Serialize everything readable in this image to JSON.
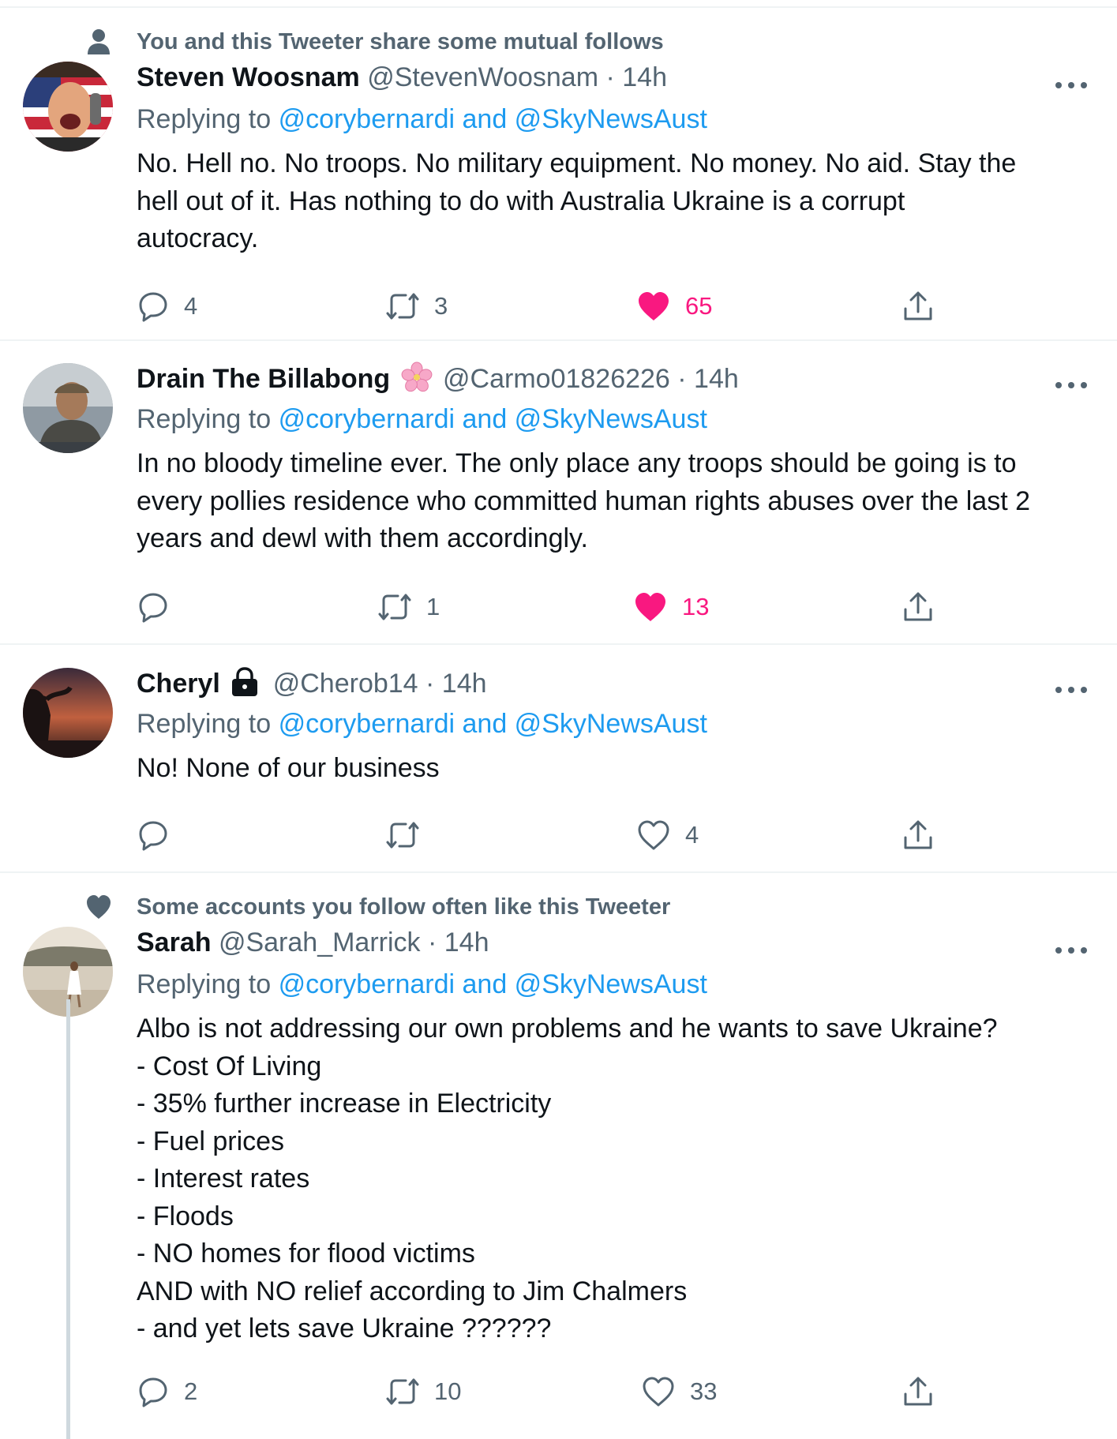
{
  "tweets": [
    {
      "social_context": "You and this Tweeter share some mutual follows",
      "social_icon": "person-icon",
      "display_name": "Steven Woosnam",
      "handle_time": "@StevenWoosnam · 14h",
      "replying_prefix": "Replying to",
      "replying_mentions": "@corybernardi and @SkyNewsAust",
      "body_lines": [
        "No. Hell no. No troops. No military equipment. No money. No aid. Stay the",
        "hell out of it. Has nothing to do with Australia Ukraine is a corrupt",
        "autocracy."
      ],
      "replies": "4",
      "retweets": "3",
      "likes": "65",
      "liked": true
    },
    {
      "display_name": "Drain The Billabong",
      "name_emoji": "cherry-blossom-emoji",
      "handle_time": "@Carmo01826226 · 14h",
      "replying_prefix": "Replying to",
      "replying_mentions": "@corybernardi and @SkyNewsAust",
      "body_lines": [
        "In no bloody timeline ever. The only place any troops should be going is to",
        "every pollies residence who committed human rights abuses over the last 2",
        "years and dewl with them accordingly."
      ],
      "replies": "",
      "retweets": "1",
      "likes": "13",
      "liked": true
    },
    {
      "display_name": "Cheryl",
      "name_icon": "lock-icon",
      "handle_time": "@Cherob14 · 14h",
      "replying_prefix": "Replying to",
      "replying_mentions": "@corybernardi and @SkyNewsAust",
      "body_lines": [
        "No! None of our business"
      ],
      "replies": "",
      "retweets": "",
      "likes": "4",
      "liked": false
    },
    {
      "social_context": "Some accounts you follow often like this Tweeter",
      "social_icon": "heart-icon",
      "display_name": "Sarah",
      "handle_time": "@Sarah_Marrick · 14h",
      "replying_prefix": "Replying to",
      "replying_mentions": "@corybernardi and @SkyNewsAust",
      "body_lines": [
        "Albo is not addressing our own problems and he wants to save Ukraine?",
        "- Cost Of Living",
        "- 35% further increase in Electricity",
        "- Fuel prices",
        "- Interest rates",
        "- Floods",
        "- NO homes for flood victims",
        "AND with NO relief according to Jim Chalmers",
        "- and yet lets save Ukraine ??????"
      ],
      "replies": "2",
      "retweets": "10",
      "likes": "33",
      "liked": false
    }
  ],
  "colors": {
    "text": "#0f1419",
    "secondary": "#536471",
    "link": "#1d9bf0",
    "like": "#f91880",
    "border": "#eff3f4"
  }
}
